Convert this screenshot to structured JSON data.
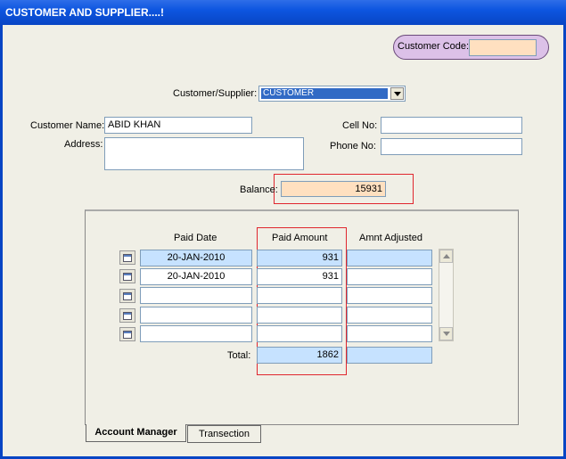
{
  "window": {
    "title": "CUSTOMER AND SUPPLIER....!"
  },
  "customer_code": {
    "label": "Customer Code:",
    "value": ""
  },
  "type_select": {
    "label": "Customer/Supplier:",
    "value": "CUSTOMER"
  },
  "customer_name": {
    "label": "Customer Name:",
    "value": "ABID KHAN"
  },
  "address": {
    "label": "Address:",
    "value": ""
  },
  "cell_no": {
    "label": "Cell No:",
    "value": ""
  },
  "phone_no": {
    "label": "Phone No:",
    "value": ""
  },
  "balance": {
    "label": "Balance:",
    "value": "15931"
  },
  "grid": {
    "headers": {
      "paid_date": "Paid Date",
      "paid_amount": "Paid Amount",
      "amnt_adjusted": "Amnt Adjusted"
    },
    "rows": [
      {
        "paid_date": "20-JAN-2010",
        "paid_amount": "931",
        "amnt_adjusted": ""
      },
      {
        "paid_date": "20-JAN-2010",
        "paid_amount": "931",
        "amnt_adjusted": ""
      },
      {
        "paid_date": "",
        "paid_amount": "",
        "amnt_adjusted": ""
      },
      {
        "paid_date": "",
        "paid_amount": "",
        "amnt_adjusted": ""
      },
      {
        "paid_date": "",
        "paid_amount": "",
        "amnt_adjusted": ""
      }
    ],
    "total": {
      "label": "Total:",
      "paid_amount": "1862",
      "amnt_adjusted": ""
    }
  },
  "tabs": [
    {
      "label": "Account Manager",
      "active": true
    },
    {
      "label": "Transection",
      "active": false
    }
  ],
  "icons": {
    "row_button": "calendar-icon",
    "scroll_up": "arrow-up-icon",
    "scroll_down": "arrow-down-icon",
    "dropdown": "chevron-down-icon"
  },
  "colors": {
    "titlebar": "#0845c4",
    "highlight_box": "#e0262e",
    "balance_bg": "#ffe0c0",
    "selected_row_bg": "#c6e2ff",
    "code_pill_bg": "#dcc1e8"
  }
}
